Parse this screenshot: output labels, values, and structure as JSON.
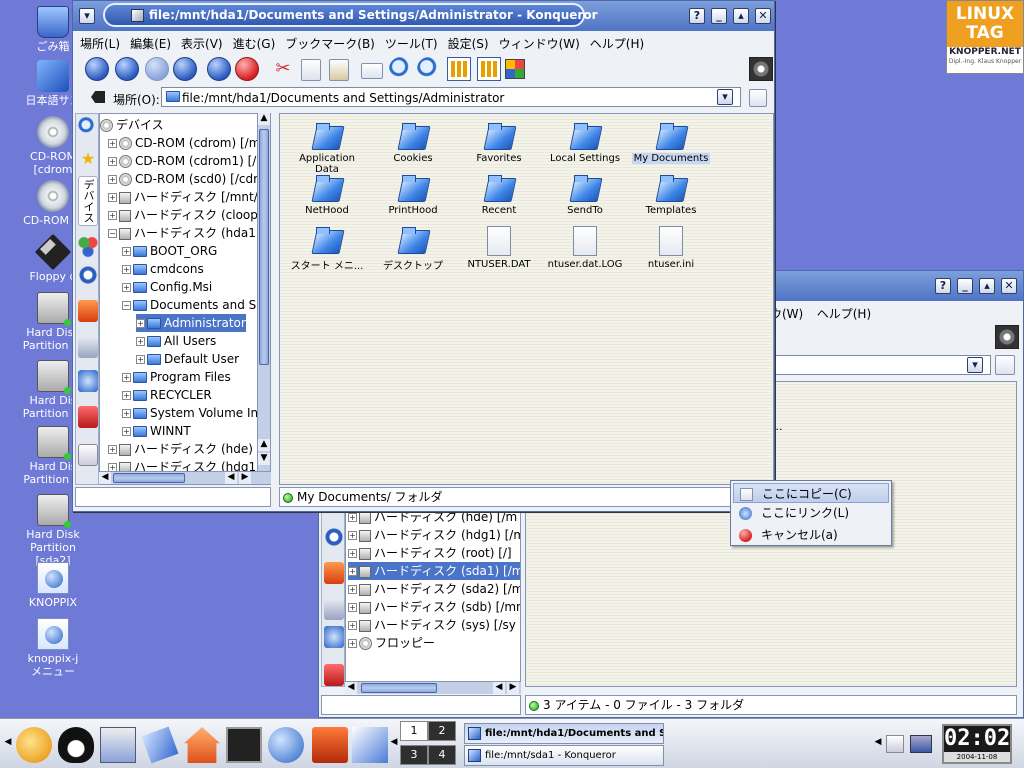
{
  "desktop": {
    "icons": [
      {
        "label": "ごみ箱",
        "icon": "trash-icon"
      },
      {
        "label": "日本語サン",
        "icon": "app-icon"
      },
      {
        "label": "CD-ROM\n[cdrom",
        "icon": "cdrom-icon"
      },
      {
        "label": "CD-ROM [c",
        "icon": "cdrom-icon"
      },
      {
        "label": "Floppy d",
        "icon": "floppy-icon"
      },
      {
        "label": "Hard Disk\nPartition [h",
        "icon": "harddisk-icon"
      },
      {
        "label": "Hard Dis\nPartition [h",
        "icon": "harddisk-icon"
      },
      {
        "label": "Hard Dis\nPartition [s",
        "icon": "harddisk-icon"
      },
      {
        "label": "Hard Disk\nPartition [sda2]",
        "icon": "harddisk-icon"
      },
      {
        "label": "KNOPPIX",
        "icon": "web-icon"
      },
      {
        "label": "knoppix-j\nメニュー",
        "icon": "web-icon"
      }
    ],
    "logo": {
      "line1": "LINUX",
      "line2": "TAG",
      "brand": "KNOPPER.NET",
      "sub": "Dipl.-Ing. Klaus Knopper"
    }
  },
  "main_window": {
    "title": "file:/mnt/hda1/Documents and Settings/Administrator - Konqueror",
    "menu": [
      "場所(L)",
      "編集(E)",
      "表示(V)",
      "進む(G)",
      "ブックマーク(B)",
      "ツール(T)",
      "設定(S)",
      "ウィンドウ(W)",
      "ヘルプ(H)"
    ],
    "location_label": "場所(O):",
    "location_value": "file:/mnt/hda1/Documents and Settings/Administrator",
    "sidebar_tab_label": "デバイス",
    "tree": [
      {
        "label": "デバイス",
        "icon": "devices-icon",
        "depth": 0
      },
      {
        "label": "CD-ROM (cdrom) [/mnt",
        "icon": "cd",
        "depth": 1
      },
      {
        "label": "CD-ROM (cdrom1) [/m",
        "icon": "cd",
        "depth": 1
      },
      {
        "label": "CD-ROM (scd0) [/cdro",
        "icon": "cd",
        "depth": 1
      },
      {
        "label": "ハードディスク [/mnt/a",
        "icon": "hd",
        "depth": 1
      },
      {
        "label": "ハードディスク (cloop)",
        "icon": "hd",
        "depth": 1
      },
      {
        "label": "ハードディスク (hda1)",
        "icon": "hd",
        "depth": 1
      },
      {
        "label": "BOOT_ORG",
        "icon": "folder",
        "depth": 2
      },
      {
        "label": "cmdcons",
        "icon": "folder",
        "depth": 2
      },
      {
        "label": "Config.Msi",
        "icon": "folder",
        "depth": 2
      },
      {
        "label": "Documents and Set",
        "icon": "folder",
        "depth": 2
      },
      {
        "label": "Administrator",
        "icon": "folder",
        "depth": 3,
        "selected": true
      },
      {
        "label": "All Users",
        "icon": "folder",
        "depth": 3
      },
      {
        "label": "Default User",
        "icon": "folder",
        "depth": 3
      },
      {
        "label": "Program Files",
        "icon": "folder",
        "depth": 2
      },
      {
        "label": "RECYCLER",
        "icon": "folder",
        "depth": 2
      },
      {
        "label": "System Volume Info",
        "icon": "folder",
        "depth": 2
      },
      {
        "label": "WINNT",
        "icon": "folder",
        "depth": 2
      },
      {
        "label": "ハードディスク (hde) [",
        "icon": "hd",
        "depth": 1
      },
      {
        "label": "ハードディスク (hdg1)",
        "icon": "hd",
        "depth": 1
      }
    ],
    "files": [
      {
        "label": "Application Data",
        "type": "folder"
      },
      {
        "label": "Cookies",
        "type": "folder"
      },
      {
        "label": "Favorites",
        "type": "folder"
      },
      {
        "label": "Local Settings",
        "type": "folder"
      },
      {
        "label": "My Documents",
        "type": "folder",
        "selected": true
      },
      {
        "label": "NetHood",
        "type": "folder"
      },
      {
        "label": "PrintHood",
        "type": "folder"
      },
      {
        "label": "Recent",
        "type": "folder"
      },
      {
        "label": "SendTo",
        "type": "folder"
      },
      {
        "label": "Templates",
        "type": "folder"
      },
      {
        "label": "スタート メニ...",
        "type": "folder"
      },
      {
        "label": "デスクトップ",
        "type": "folder"
      },
      {
        "label": "NTUSER.DAT",
        "type": "file"
      },
      {
        "label": "ntuser.dat.LOG",
        "type": "file"
      },
      {
        "label": "ntuser.ini",
        "type": "file"
      }
    ],
    "status": "My Documents/  フォルダ"
  },
  "back_window": {
    "menu": [
      "ウ(W)",
      "ヘルプ(H)"
    ],
    "tree": [
      {
        "label": "ハードディスク (hde) [/m",
        "icon": "hd"
      },
      {
        "label": "ハードディスク (hdg1) [/m",
        "icon": "hd"
      },
      {
        "label": "ハードディスク (root) [/]",
        "icon": "hd"
      },
      {
        "label": "ハードディスク (sda1) [/m",
        "icon": "hd",
        "selected": true
      },
      {
        "label": "ハードディスク (sda2) [/m",
        "icon": "hd"
      },
      {
        "label": "ハードディスク (sdb) [/mn",
        "icon": "hd"
      },
      {
        "label": "ハードディスク (sys) [/sy",
        "icon": "hd"
      },
      {
        "label": "フロッピー",
        "icon": "floppy"
      }
    ],
    "ellipsis": "...",
    "status": "3 アイテム - 0 ファイル - 3 フォルダ"
  },
  "context_menu": {
    "items": [
      {
        "label": "ここにコピー(C)",
        "icon": "copy-icon",
        "highlighted": true
      },
      {
        "label": "ここにリンク(L)",
        "icon": "link-icon"
      },
      {
        "label": "キャンセル(a)",
        "icon": "cancel-icon"
      }
    ]
  },
  "taskbar": {
    "pager": [
      "1",
      "2",
      "3",
      "4"
    ],
    "active_desktop": "1",
    "tasks": [
      {
        "label": "file:/mnt/hda1/Documents and Settin",
        "active": true
      },
      {
        "label": "file:/mnt/sda1 - Konqueror",
        "active": false
      }
    ],
    "clock_time": "02:02",
    "clock_date": "2004-11-08"
  },
  "colors": {
    "desktop": "#6f79d6",
    "titlebar": "#4f74c4",
    "selection": "#4a74c8"
  }
}
